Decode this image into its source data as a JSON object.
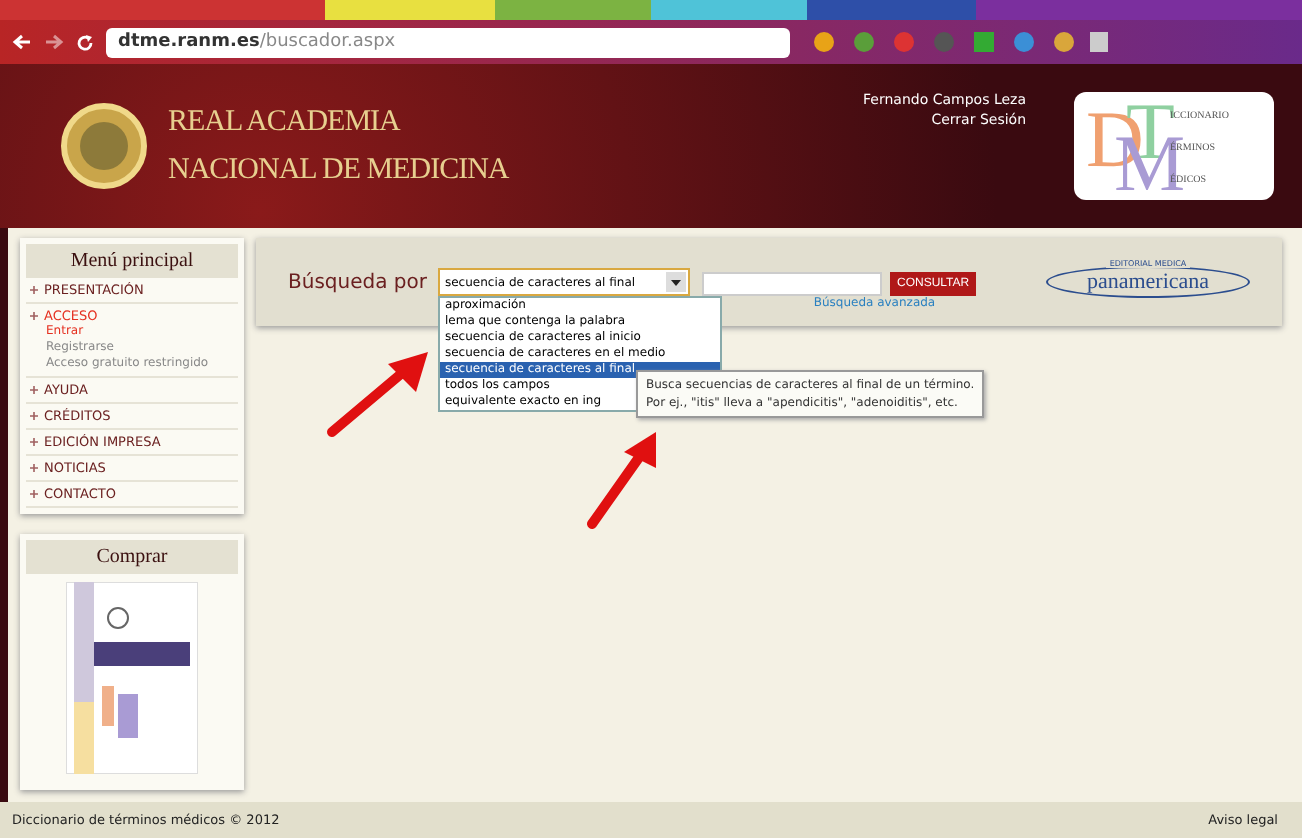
{
  "browser": {
    "url_host": "dtme.ranm.es",
    "url_path": "/buscador.aspx"
  },
  "header": {
    "title_lines": [
      "REAL ACADEMIA",
      "NACIONAL DE MEDICINA"
    ],
    "user": "Fernando Campos Leza",
    "logout": "Cerrar Sesión",
    "logo": {
      "letters": [
        "D",
        "T",
        "M"
      ],
      "words": [
        "ICCIONARIO",
        "ÉRMINOS",
        "ÉDICOS"
      ]
    }
  },
  "sidebar": {
    "menu_title": "Menú principal",
    "items": [
      {
        "label": "PRESENTACIÓN",
        "active": false
      },
      {
        "label": "ACCESO",
        "active": true,
        "children": [
          {
            "label": "Entrar",
            "active": true
          },
          {
            "label": "Registrarse",
            "active": false
          },
          {
            "label": "Acceso gratuito restringido",
            "active": false
          }
        ]
      },
      {
        "label": "AYUDA",
        "active": false
      },
      {
        "label": "CRÉDITOS",
        "active": false
      },
      {
        "label": "EDICIÓN IMPRESA",
        "active": false
      },
      {
        "label": "NOTICIAS",
        "active": false
      },
      {
        "label": "CONTACTO",
        "active": false
      }
    ],
    "buy_title": "Comprar"
  },
  "search": {
    "label": "Búsqueda por",
    "select_value": "secuencia de caracteres al final",
    "options": [
      {
        "label": "aproximación",
        "selected": false
      },
      {
        "label": "lema que contenga la palabra",
        "selected": false
      },
      {
        "label": "secuencia de caracteres al inicio",
        "selected": false
      },
      {
        "label": "secuencia de caracteres en el medio",
        "selected": false
      },
      {
        "label": "secuencia de caracteres al final",
        "selected": true
      },
      {
        "label": "todos los campos",
        "selected": false
      },
      {
        "label": "equivalente exacto en ing",
        "selected": false
      }
    ],
    "button": "CONSULTAR",
    "advanced_link": "Búsqueda avanzada",
    "publisher": {
      "top": "EDITORIAL MEDICA",
      "name": "panamericana"
    },
    "tooltip": [
      "Busca secuencias de caracteres al final de un término.",
      "Por ej., \"itis\" lleva a \"apendicitis\", \"adenoiditis\", etc."
    ]
  },
  "footer": {
    "left": "Diccionario de términos médicos © 2012",
    "right": "Aviso legal"
  }
}
